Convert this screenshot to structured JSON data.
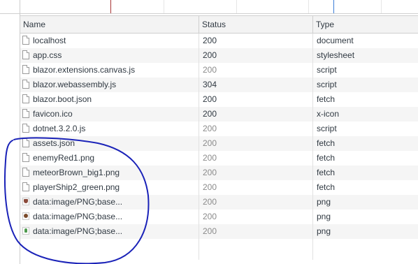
{
  "columns": {
    "name": "Name",
    "status": "Status",
    "type": "Type"
  },
  "requests": [
    {
      "name": "localhost",
      "status": "200",
      "type": "document",
      "icon": "file-icon",
      "status_muted": false
    },
    {
      "name": "app.css",
      "status": "200",
      "type": "stylesheet",
      "icon": "file-icon",
      "status_muted": false
    },
    {
      "name": "blazor.extensions.canvas.js",
      "status": "200",
      "type": "script",
      "icon": "file-icon",
      "status_muted": true
    },
    {
      "name": "blazor.webassembly.js",
      "status": "304",
      "type": "script",
      "icon": "file-icon",
      "status_muted": false
    },
    {
      "name": "blazor.boot.json",
      "status": "200",
      "type": "fetch",
      "icon": "file-icon",
      "status_muted": false
    },
    {
      "name": "favicon.ico",
      "status": "200",
      "type": "x-icon",
      "icon": "file-icon",
      "status_muted": false
    },
    {
      "name": "dotnet.3.2.0.js",
      "status": "200",
      "type": "script",
      "icon": "file-icon",
      "status_muted": true
    },
    {
      "name": "assets.json",
      "status": "200",
      "type": "fetch",
      "icon": "file-icon",
      "status_muted": true
    },
    {
      "name": "enemyRed1.png",
      "status": "200",
      "type": "fetch",
      "icon": "file-icon",
      "status_muted": true
    },
    {
      "name": "meteorBrown_big1.png",
      "status": "200",
      "type": "fetch",
      "icon": "file-icon",
      "status_muted": true
    },
    {
      "name": "playerShip2_green.png",
      "status": "200",
      "type": "fetch",
      "icon": "file-icon",
      "status_muted": true
    },
    {
      "name": "data:image/PNG;base...",
      "status": "200",
      "type": "png",
      "icon": "enemy-thumbnail-icon",
      "status_muted": true
    },
    {
      "name": "data:image/PNG;base...",
      "status": "200",
      "type": "png",
      "icon": "meteor-thumbnail-icon",
      "status_muted": true
    },
    {
      "name": "data:image/PNG;base...",
      "status": "200",
      "type": "png",
      "icon": "ship-thumbnail-icon",
      "status_muted": true
    }
  ],
  "colors": {
    "annotation": "#1a22b8",
    "status_muted": "#8b8b8b",
    "text": "#303942",
    "marker_red": "#a73333",
    "marker_blue": "#3b7ed6"
  }
}
